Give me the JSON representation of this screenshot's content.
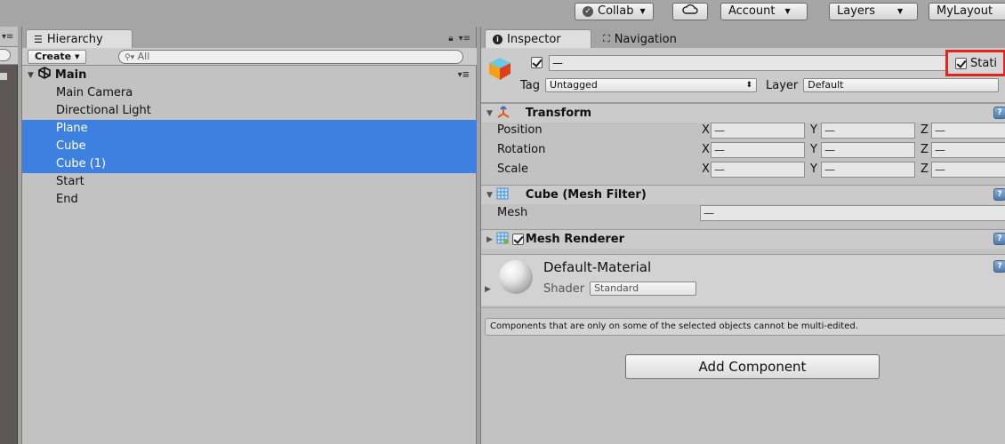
{
  "toolbar": {
    "collab_label": "Collab",
    "account_label": "Account",
    "layers_label": "Layers",
    "layout_label": "MyLayout"
  },
  "hierarchy": {
    "tab_label": "Hierarchy",
    "create_label": "Create",
    "search_placeholder": "All",
    "scene_name": "Main",
    "items": [
      {
        "label": "Main Camera",
        "selected": false
      },
      {
        "label": "Directional Light",
        "selected": false
      },
      {
        "label": "Plane",
        "selected": true
      },
      {
        "label": "Cube",
        "selected": true
      },
      {
        "label": "Cube (1)",
        "selected": true
      },
      {
        "label": "Start",
        "selected": false
      },
      {
        "label": "End",
        "selected": false
      }
    ]
  },
  "inspector": {
    "tab_label": "Inspector",
    "nav_tab_label": "Navigation",
    "name_value": "—",
    "static_label": "Stati",
    "tag_label": "Tag",
    "tag_value": "Untagged",
    "layer_label": "Layer",
    "layer_value": "Default",
    "transform": {
      "title": "Transform",
      "rows": [
        {
          "label": "Position",
          "x": "—",
          "y": "—",
          "z": "—"
        },
        {
          "label": "Rotation",
          "x": "—",
          "y": "—",
          "z": "—"
        },
        {
          "label": "Scale",
          "x": "—",
          "y": "—",
          "z": "—"
        }
      ],
      "axis_x": "X",
      "axis_y": "Y",
      "axis_z": "Z"
    },
    "mesh_filter": {
      "title": "Cube (Mesh Filter)",
      "mesh_label": "Mesh",
      "mesh_value": "—"
    },
    "mesh_renderer": {
      "title": "Mesh Renderer"
    },
    "material": {
      "name": "Default-Material",
      "shader_label": "Shader",
      "shader_value": "Standard"
    },
    "notice": "Components that are only on some of the selected objects cannot be multi-edited.",
    "add_component_label": "Add Component"
  },
  "colors": {
    "selection": "#3d80df",
    "highlight_box": "#e3241c",
    "panel_bg": "#c2c2c2"
  }
}
